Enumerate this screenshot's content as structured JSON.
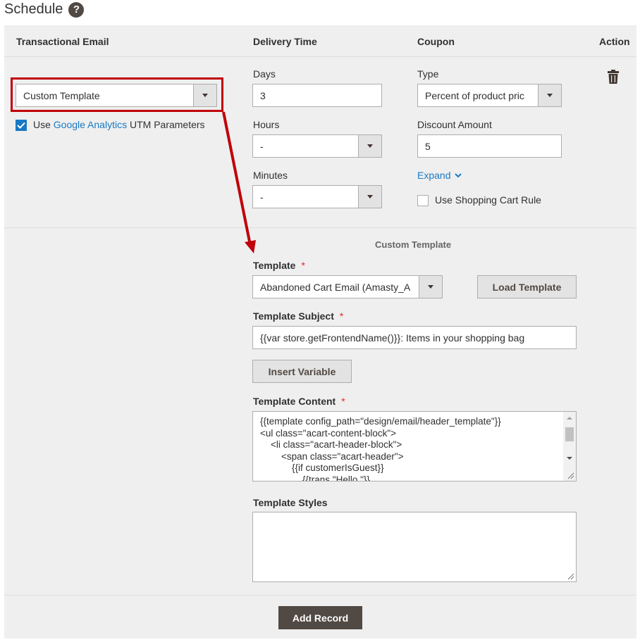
{
  "page": {
    "title": "Schedule"
  },
  "columns": {
    "transactional_email": "Transactional Email",
    "delivery_time": "Delivery Time",
    "coupon": "Coupon",
    "action": "Action"
  },
  "transactional": {
    "template_select": "Custom Template",
    "analytics_prefix": "Use",
    "analytics_link": "Google Analytics",
    "analytics_suffix": "UTM Parameters",
    "analytics_checked": true
  },
  "delivery": {
    "days_label": "Days",
    "days_value": "3",
    "hours_label": "Hours",
    "hours_value": "-",
    "minutes_label": "Minutes",
    "minutes_value": "-"
  },
  "coupon": {
    "type_label": "Type",
    "type_value": "Percent of product pric",
    "discount_label": "Discount Amount",
    "discount_value": "5",
    "expand_label": "Expand",
    "cart_rule_label": "Use Shopping Cart Rule",
    "cart_rule_checked": false
  },
  "custom_template": {
    "section_title": "Custom Template",
    "template_label": "Template",
    "template_value": "Abandoned Cart Email (Amasty_A",
    "load_button": "Load Template",
    "subject_label": "Template Subject",
    "subject_value": "{{var store.getFrontendName()}}: Items in your shopping bag",
    "insert_variable_button": "Insert Variable",
    "content_label": "Template Content",
    "content_lines": [
      "{{template config_path=\"design/email/header_template\"}}",
      "<ul class=\"acart-content-block\">",
      "    <li class=\"acart-header-block\">",
      "        <span class=\"acart-header\">",
      "            {{if customerIsGuest}}",
      "                {{trans \"Hello,\"}}"
    ],
    "styles_label": "Template Styles",
    "styles_value": ""
  },
  "footer": {
    "add_record_button": "Add Record"
  },
  "colors": {
    "accent_red": "#c0000a",
    "link_blue": "#1979c3",
    "dark_button": "#514943"
  },
  "icons": {
    "help": "question-circle-icon",
    "trash": "trash-icon",
    "chevron": "chevron-down-icon",
    "arrow": "annotation-arrow"
  }
}
